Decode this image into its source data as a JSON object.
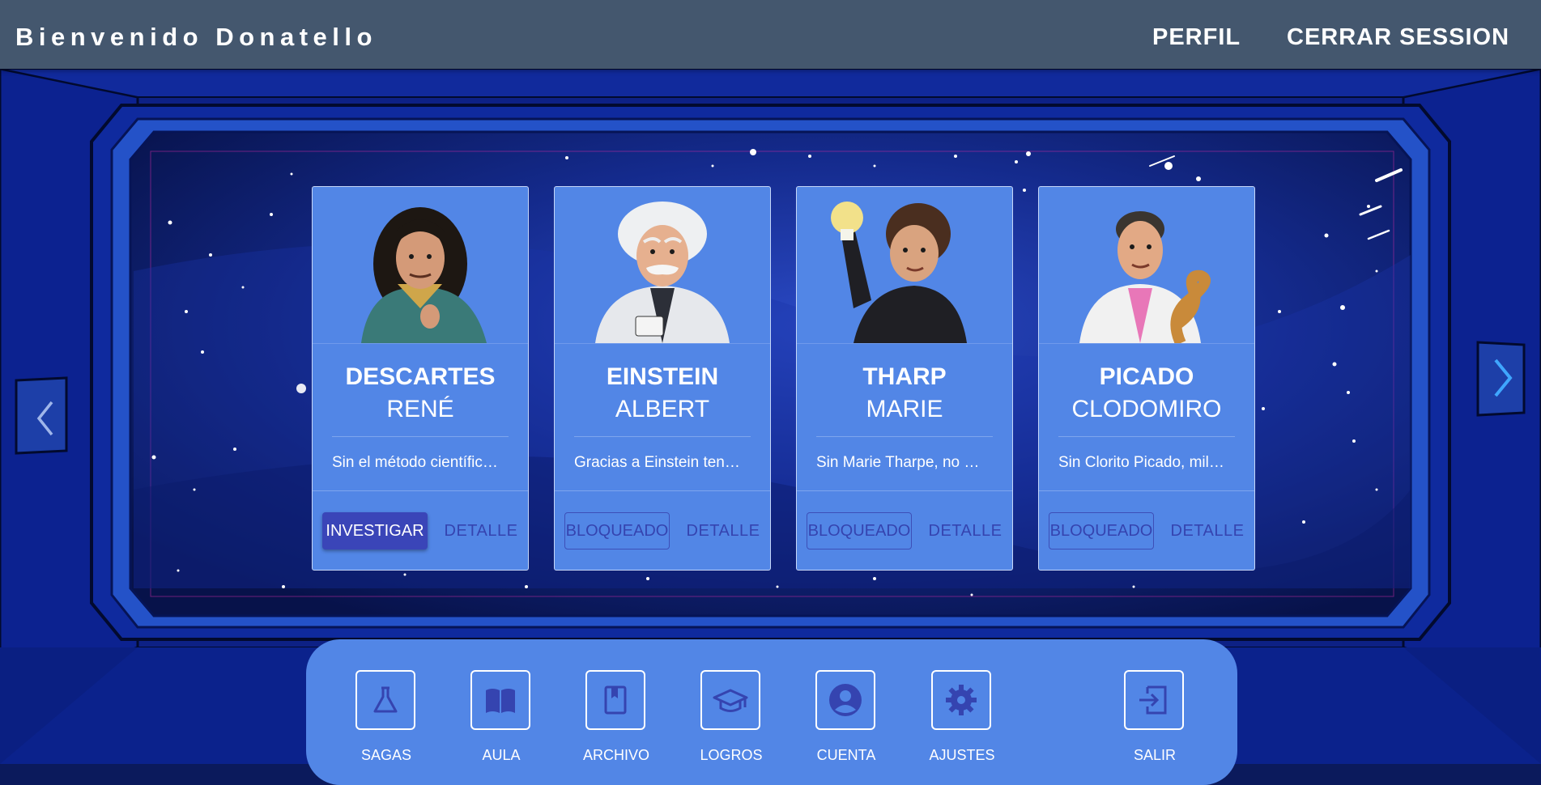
{
  "header": {
    "welcome": "Bienvenido Donatello",
    "profile_link": "PERFIL",
    "logout_link": "CERRAR SESSION"
  },
  "cards": [
    {
      "surname": "DESCARTES",
      "firstname": "RENÉ",
      "description": "Sin el método científic…",
      "action": "INVESTIGAR",
      "action_state": "enabled",
      "detail": "DETALLE",
      "portrait": "descartes-portrait"
    },
    {
      "surname": "EINSTEIN",
      "firstname": "ALBERT",
      "description": "Gracias a Einstein ten…",
      "action": "BLOQUEADO",
      "action_state": "locked",
      "detail": "DETALLE",
      "portrait": "einstein-portrait"
    },
    {
      "surname": "THARP",
      "firstname": "MARIE",
      "description": "Sin Marie Tharpe, no …",
      "action": "BLOQUEADO",
      "action_state": "locked",
      "detail": "DETALLE",
      "portrait": "tharp-portrait"
    },
    {
      "surname": "PICADO",
      "firstname": "CLODOMIRO",
      "description": "Sin Clorito Picado, mil…",
      "action": "BLOQUEADO",
      "action_state": "locked",
      "detail": "DETALLE",
      "portrait": "picado-portrait"
    }
  ],
  "carousel": {
    "prev_icon": "chevron-left-icon",
    "next_icon": "chevron-right-icon"
  },
  "dock": [
    {
      "label": "SAGAS",
      "icon": "flask-icon"
    },
    {
      "label": "AULA",
      "icon": "open-book-icon"
    },
    {
      "label": "ARCHIVO",
      "icon": "bookmark-book-icon"
    },
    {
      "label": "LOGROS",
      "icon": "graduation-cap-icon"
    },
    {
      "label": "CUENTA",
      "icon": "account-circle-icon"
    },
    {
      "label": "AJUSTES",
      "icon": "gear-icon"
    },
    {
      "label": "SALIR",
      "icon": "exit-icon"
    }
  ],
  "colors": {
    "header_bg": "#44576e",
    "card_bg": "#5286e6",
    "primary_button": "#3a45b8",
    "locked_text": "#3544b0",
    "space_bg": "#0b1a5c"
  }
}
